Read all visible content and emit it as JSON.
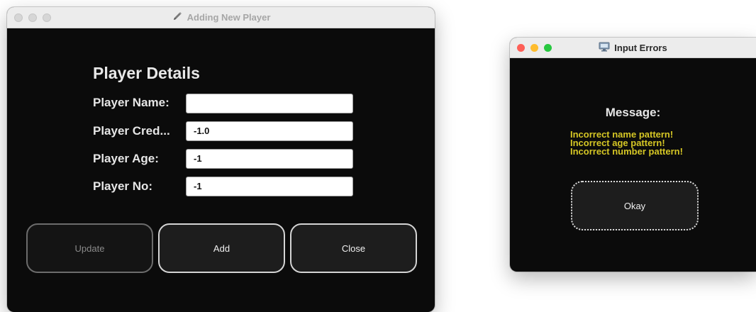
{
  "main_window": {
    "title": "Adding New Player",
    "title_icon": "pencil-icon",
    "heading": "Player Details",
    "fields": [
      {
        "label": "Player Name:",
        "value": ""
      },
      {
        "label": "Player Cred...",
        "value": "-1.0"
      },
      {
        "label": "Player Age:",
        "value": "-1"
      },
      {
        "label": "Player No:",
        "value": "-1"
      }
    ],
    "buttons": {
      "update": "Update",
      "add": "Add",
      "close": "Close"
    }
  },
  "error_window": {
    "title": "Input Errors",
    "title_icon": "monitor-icon",
    "message_title": "Message:",
    "errors": [
      "Incorrect name pattern!",
      "Incorrect age pattern!",
      "Incorrect number pattern!"
    ],
    "okay_label": "Okay"
  },
  "colors": {
    "window_bg": "#0b0b0b",
    "error_text": "#d6c725",
    "traffic_red": "#fe5f57",
    "traffic_yellow": "#febc2e",
    "traffic_green": "#28c840"
  }
}
